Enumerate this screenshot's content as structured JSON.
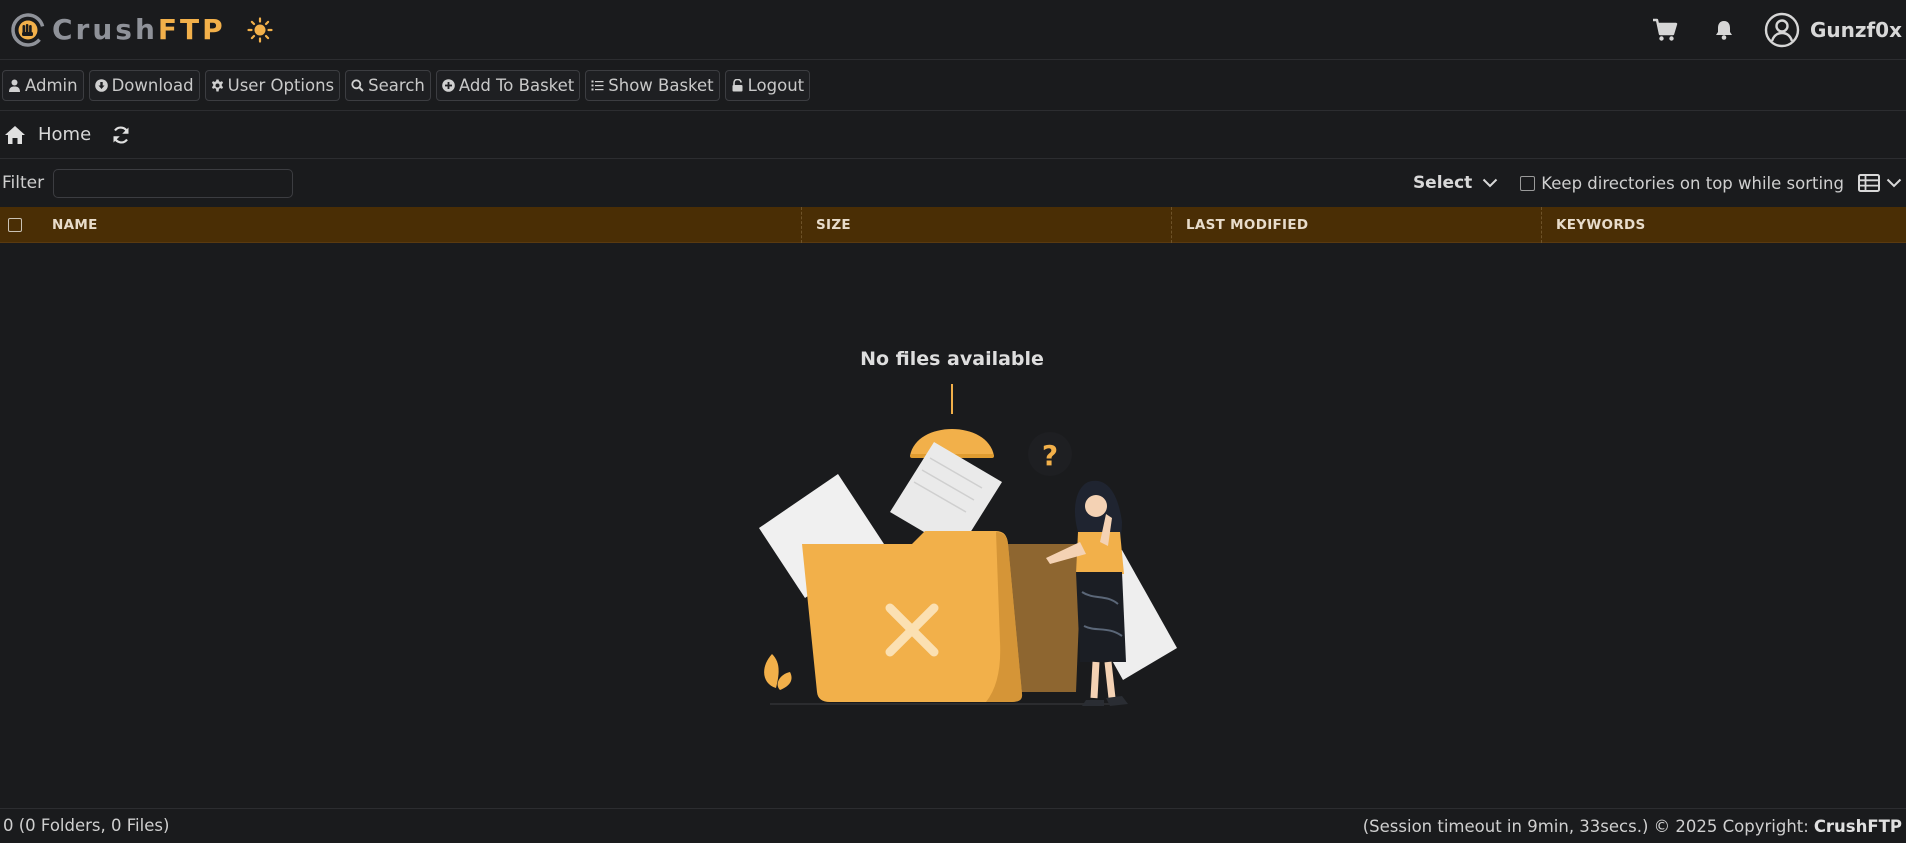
{
  "header": {
    "logo_crush": "Crush",
    "logo_ftp": "FTP",
    "username": "Gunzf0x"
  },
  "toolbar": {
    "buttons": [
      {
        "label": "Admin",
        "icon": "user-icon"
      },
      {
        "label": "Download",
        "icon": "download-icon"
      },
      {
        "label": "User Options",
        "icon": "gear-icon"
      },
      {
        "label": "Search",
        "icon": "search-icon"
      },
      {
        "label": "Add To Basket",
        "icon": "plus-circle-icon"
      },
      {
        "label": "Show Basket",
        "icon": "list-icon"
      },
      {
        "label": "Logout",
        "icon": "unlock-icon"
      }
    ]
  },
  "breadcrumb": {
    "home_label": "Home"
  },
  "filter": {
    "label": "Filter",
    "value": "",
    "select_label": "Select",
    "keep_dirs_label": "Keep directories on top while sorting",
    "keep_dirs_checked": false
  },
  "table": {
    "columns": [
      "NAME",
      "SIZE",
      "LAST MODIFIED",
      "KEYWORDS"
    ],
    "rows": []
  },
  "empty": {
    "title": "No files available",
    "question_mark": "?"
  },
  "footer": {
    "summary": "0 (0 Folders, 0 Files)",
    "session": "(Session timeout in 9min, 33secs.) © 2025 Copyright:",
    "brand": "CrushFTP"
  },
  "colors": {
    "accent": "#f2b04a",
    "header_row": "#4a2e05",
    "background": "#1a1b1d"
  }
}
